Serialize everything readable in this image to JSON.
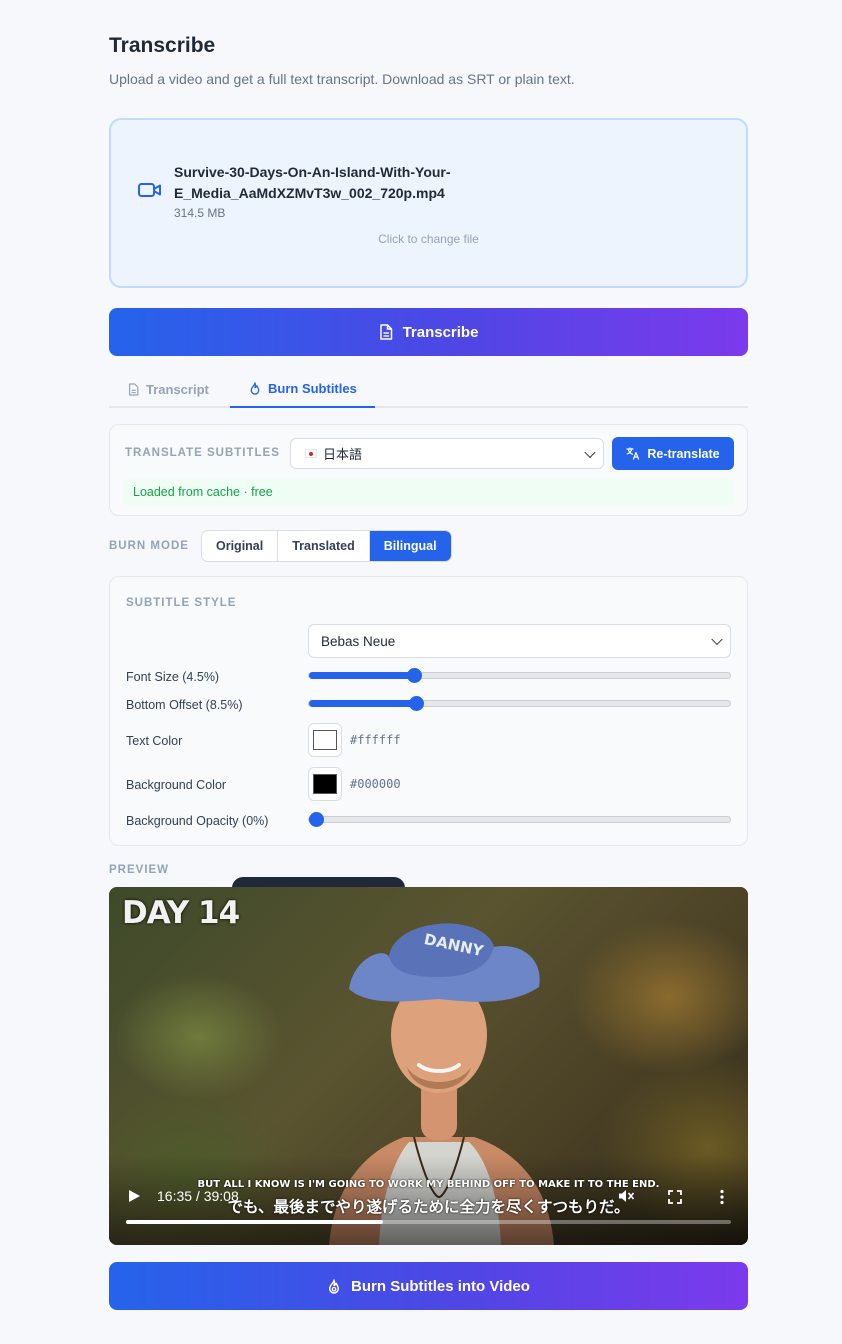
{
  "page": {
    "title": "Transcribe",
    "subtitle": "Upload a video and get a full text transcript. Download as SRT or plain text."
  },
  "upload": {
    "file_name_line1": "Survive-30-Days-On-An-Island-With-Your-",
    "file_name_line2": "E_Media_AaMdXZMvT3w_002_720p.mp4",
    "file_size": "314.5 MB",
    "change_hint": "Click to change file",
    "icon": "video-icon"
  },
  "actions": {
    "transcribe_label": "Transcribe",
    "burn_label": "Burn Subtitles into Video"
  },
  "tabs": [
    {
      "label": "Transcript",
      "icon": "document-icon",
      "active": false
    },
    {
      "label": "Burn Subtitles",
      "icon": "flame-icon",
      "active": true
    }
  ],
  "translate": {
    "label": "Translate Subtitles",
    "selected_language": "日本語",
    "retranslate_label": "Re-translate",
    "cache_status": "Loaded from cache · free"
  },
  "burn_mode": {
    "label": "Burn Mode",
    "options": [
      "Original",
      "Translated",
      "Bilingual"
    ],
    "selected": "Bilingual"
  },
  "subtitle_style": {
    "label": "Subtitle Style",
    "font": "Bebas Neue",
    "font_size_label": "Font Size (4.5%)",
    "font_size_fraction": 0.25,
    "bottom_offset_label": "Bottom Offset (8.5%)",
    "bottom_offset_fraction": 0.255,
    "text_color_label": "Text Color",
    "text_color": "#ffffff",
    "bg_color_label": "Background Color",
    "bg_color": "#000000",
    "bg_opacity_label": "Background Opacity (0%)",
    "bg_opacity_fraction": 0
  },
  "preview": {
    "label": "Preview",
    "overlay_text": "DAY 14",
    "hat_text": "DANNY",
    "subtitle_en": "BUT ALL I KNOW IS I'M GOING TO WORK MY BEHIND OFF TO MAKE IT TO THE END.",
    "subtitle_ja": "でも、最後までやり遂げるために全力を尽くすつもりだ。",
    "time": "16:35 / 39:08",
    "progress_fraction": 0.424
  },
  "colors": {
    "accent": "#2563eb",
    "gradient_end": "#7c3aed",
    "success": "#16a34a"
  }
}
